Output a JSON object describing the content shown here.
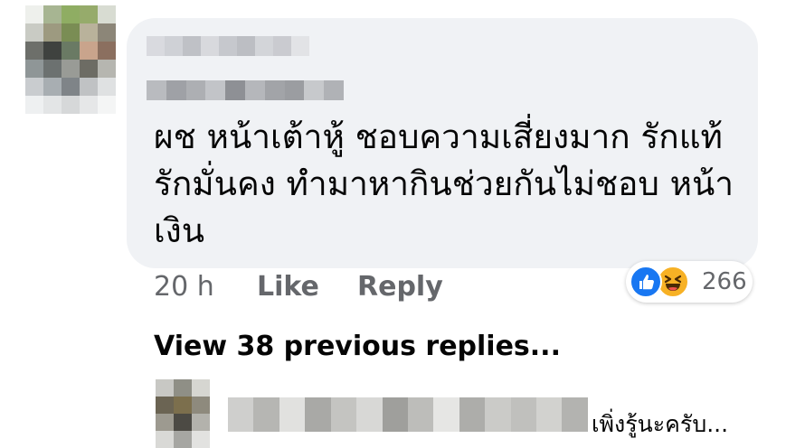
{
  "comment": {
    "author_name": "",
    "text_lines": [
      "ผช หน้าเต้าหู้ ชอบความเสี่ยงมาก รักแท้",
      "รักมั่นคง ทำมาหากินช่วยกันไม่ชอบ หน้า",
      "เงิน"
    ],
    "timestamp": "20 h",
    "like_label": "Like",
    "reply_label": "Reply",
    "reactions": {
      "icons": [
        "like-icon",
        "haha-icon"
      ],
      "count": "266",
      "like_color": "#1877f2",
      "haha_color": "#f7b125"
    }
  },
  "replies": {
    "view_previous_label": "View 38 previous replies...",
    "latest_reply": {
      "author_name": "",
      "snippet": "เพิ่งรู้นะครับ..."
    }
  },
  "colors": {
    "bubble_bg": "#f0f2f5",
    "meta_text": "#65676b",
    "body_text": "#050505"
  }
}
